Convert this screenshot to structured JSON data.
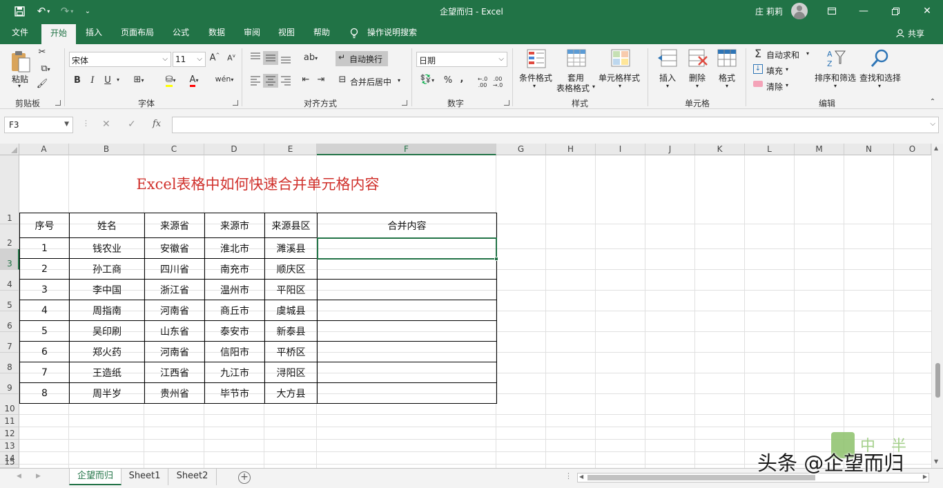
{
  "title_bar": {
    "document_title": "企望而归  -  Excel",
    "user_name": "庄 莉莉"
  },
  "ribbon_tabs": [
    "文件",
    "开始",
    "插入",
    "页面布局",
    "公式",
    "数据",
    "审阅",
    "视图",
    "帮助",
    "操作说明搜索"
  ],
  "active_tab": "开始",
  "share_label": "共享",
  "ribbon": {
    "clipboard": {
      "paste": "粘贴",
      "group": "剪贴板"
    },
    "font": {
      "name": "宋体",
      "size": "11",
      "bold": "B",
      "italic": "I",
      "underline": "U",
      "group": "字体"
    },
    "alignment": {
      "wrap": "自动换行",
      "merge": "合并后居中",
      "group": "对齐方式"
    },
    "number": {
      "format": "日期",
      "percent": "%",
      "comma": ",",
      "group": "数字"
    },
    "styles": {
      "conditional": "条件格式",
      "table_1": "套用",
      "table_2": "表格格式",
      "cell_styles": "单元格样式",
      "group": "样式"
    },
    "cells": {
      "insert": "插入",
      "delete": "删除",
      "format": "格式",
      "group": "单元格"
    },
    "editing": {
      "autosum": "自动求和",
      "fill": "填充",
      "clear": "清除",
      "sort": "排序和筛选",
      "find": "查找和选择",
      "group": "编辑"
    }
  },
  "formula_bar": {
    "name_box": "F3",
    "fx": "fx",
    "content": ""
  },
  "columns": [
    "A",
    "B",
    "C",
    "D",
    "E",
    "F",
    "G",
    "H",
    "I",
    "J",
    "K",
    "L",
    "M",
    "N",
    "O"
  ],
  "rows": [
    "1",
    "2",
    "3",
    "4",
    "5",
    "6",
    "7",
    "8",
    "9",
    "10",
    "11",
    "12",
    "13",
    "14",
    "15"
  ],
  "selected_cell": "F3",
  "sheet_title": "Excel表格中如何快速合并单元格内容",
  "table": {
    "headers": [
      "序号",
      "姓名",
      "来源省",
      "来源市",
      "来源县区",
      "合并内容"
    ],
    "rows": [
      [
        "1",
        "钱农业",
        "安徽省",
        "淮北市",
        "濉溪县",
        ""
      ],
      [
        "2",
        "孙工商",
        "四川省",
        "南充市",
        "顺庆区",
        ""
      ],
      [
        "3",
        "李中国",
        "浙江省",
        "温州市",
        "平阳区",
        ""
      ],
      [
        "4",
        "周指南",
        "河南省",
        "商丘市",
        "虞城县",
        ""
      ],
      [
        "5",
        "吴印刷",
        "山东省",
        "泰安市",
        "新泰县",
        ""
      ],
      [
        "6",
        "郑火药",
        "河南省",
        "信阳市",
        "平桥区",
        ""
      ],
      [
        "7",
        "王造纸",
        "江西省",
        "九江市",
        "浔阳区",
        ""
      ],
      [
        "8",
        "周半岁",
        "贵州省",
        "毕节市",
        "大方县",
        ""
      ]
    ]
  },
  "sheet_tabs": [
    "企望而归",
    "Sheet1",
    "Sheet2"
  ],
  "active_sheet": "企望而归",
  "watermark": {
    "logo_text": "中 半",
    "text": "头条 @企望而归"
  },
  "colors": {
    "accent": "#217346",
    "title_red": "#d0302b"
  }
}
